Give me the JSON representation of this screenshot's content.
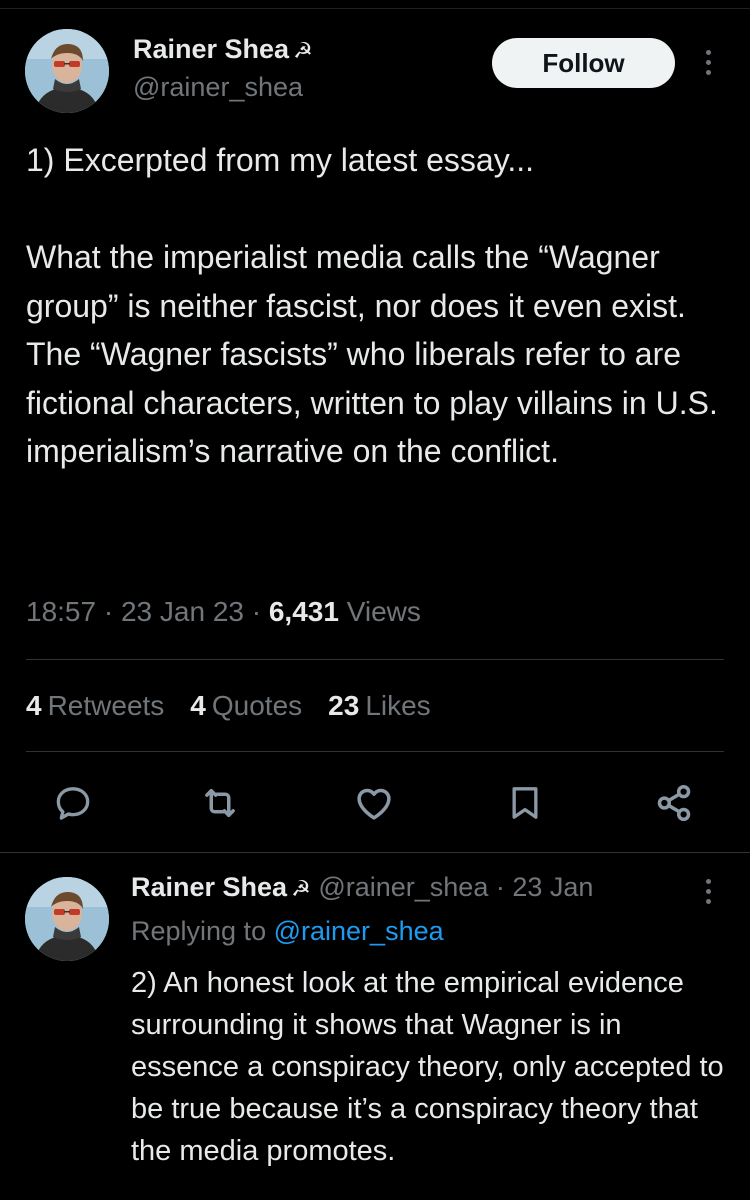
{
  "tweet": {
    "author_name": "Rainer Shea",
    "author_badge": "☭",
    "author_handle": "@rainer_shea",
    "follow_label": "Follow",
    "text_line1": "1) Excerpted from my latest essay...",
    "text_para2": "What the imperialist media calls the “Wagner group” is neither fascist, nor does it even exist. The “Wagner fascists” who liberals refer to are fictional characters, written to play villains in U.S. imperialism’s narrative on the conflict.",
    "time": "18:57",
    "date": "23 Jan 23",
    "views_count": "6,431",
    "views_label": "Views",
    "retweets_count": "4",
    "retweets_label": "Retweets",
    "quotes_count": "4",
    "quotes_label": "Quotes",
    "likes_count": "23",
    "likes_label": "Likes",
    "actions": [
      "reply-icon",
      "retweet-icon",
      "like-icon",
      "bookmark-icon",
      "share-icon"
    ]
  },
  "reply": {
    "author_name": "Rainer Shea",
    "author_badge": "☭",
    "author_handle": "@rainer_shea",
    "date": "23 Jan",
    "replying_label": "Replying to",
    "replying_to": "@rainer_shea",
    "text": "2) An honest look at the empirical evidence surrounding it shows that Wagner is in essence a conspiracy theory, only accepted to be true because it’s a conspiracy theory that the media promotes."
  },
  "colors": {
    "background": "#000000",
    "text_primary": "#e7e9ea",
    "text_secondary": "#71767b",
    "link": "#1d9bf0",
    "divider": "#2f3336",
    "follow_bg": "#eff3f4"
  }
}
